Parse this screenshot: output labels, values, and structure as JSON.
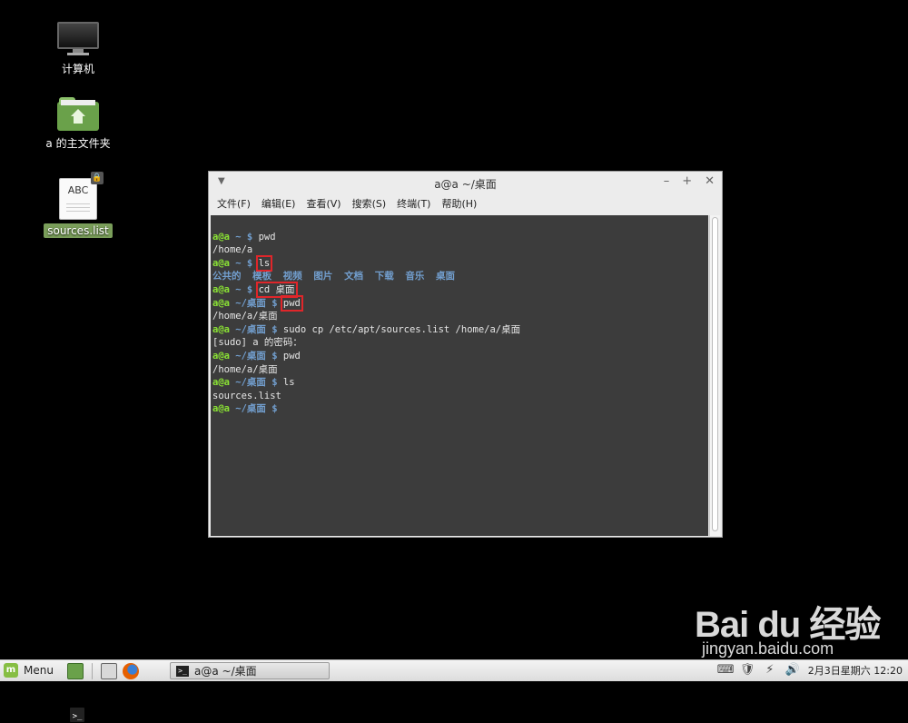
{
  "desktop": {
    "icons": [
      {
        "label": "计算机",
        "icon": "computer-icon"
      },
      {
        "label": "a 的主文件夹",
        "icon": "home-folder-icon"
      },
      {
        "label": "sources.list",
        "icon": "text-file-icon",
        "overlay_icon": "lock-icon",
        "icon_text": "ABC"
      }
    ]
  },
  "terminal_window": {
    "title": "a@a ~/桌面",
    "controls": [
      "–",
      "+",
      "✕"
    ],
    "menu": [
      "文件(F)",
      "编辑(E)",
      "查看(V)",
      "搜索(S)",
      "终端(T)",
      "帮助(H)"
    ],
    "lines": [
      {
        "user": "a@a",
        "path": " ~ $",
        "cmd": " pwd"
      },
      {
        "out": "/home/a"
      },
      {
        "user": "a@a",
        "path": " ~ $",
        "cmd": " ls",
        "highlight": "ls"
      },
      {
        "dirs": "公共的  模板  视频  图片  文档  下载  音乐  桌面"
      },
      {
        "user": "a@a",
        "path": " ~ $",
        "cmd": " cd 桌面",
        "highlight": "cd 桌面"
      },
      {
        "user": "a@a",
        "path": " ~/桌面 $",
        "cmd": " pwd",
        "highlight": "pwd"
      },
      {
        "out": "/home/a/桌面"
      },
      {
        "user": "a@a",
        "path": " ~/桌面 $",
        "cmd": " sudo cp /etc/apt/sources.list /home/a/桌面"
      },
      {
        "out": "[sudo] a 的密码："
      },
      {
        "user": "a@a",
        "path": " ~/桌面 $",
        "cmd": " pwd"
      },
      {
        "out": "/home/a/桌面"
      },
      {
        "user": "a@a",
        "path": " ~/桌面 $",
        "cmd": " ls"
      },
      {
        "out": "sources.list"
      },
      {
        "user": "a@a",
        "path": " ~/桌面 $",
        "cmd": ""
      }
    ]
  },
  "taskbar": {
    "menu_label": "Menu",
    "task_label": "a@a ~/桌面",
    "clock": "2月3日星期六 12:20"
  },
  "watermark": {
    "logo": "Bai du 经验",
    "url": "jingyan.baidu.com"
  },
  "colors": {
    "prompt_user": "#8ae234",
    "prompt_path": "#729fcf",
    "highlight_box": "#e0262a",
    "terminal_bg": "#3c3c3c"
  }
}
